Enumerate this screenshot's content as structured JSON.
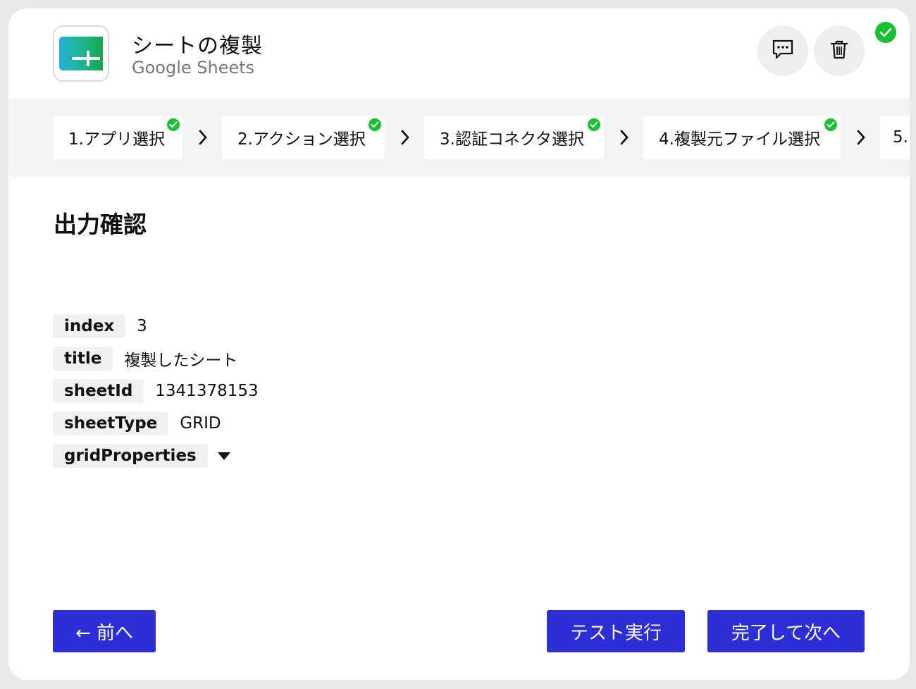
{
  "header": {
    "title": "シートの複製",
    "subtitle": "Google Sheets",
    "app_icon": "google-sheets-icon",
    "comment_icon": "comment-icon",
    "delete_icon": "trash-icon",
    "status": "complete"
  },
  "steps": [
    {
      "label": "1.アプリ選択",
      "done": true
    },
    {
      "label": "2.アクション選択",
      "done": true
    },
    {
      "label": "3.認証コネクタ選択",
      "done": true
    },
    {
      "label": "4.複製元ファイル選択",
      "done": true
    },
    {
      "label": "5.",
      "done": false
    }
  ],
  "main": {
    "section_title": "出力確認",
    "fields": [
      {
        "key": "index",
        "value": "3"
      },
      {
        "key": "title",
        "value": "複製したシート"
      },
      {
        "key": "sheetId",
        "value": "1341378153"
      },
      {
        "key": "sheetType",
        "value": "GRID"
      },
      {
        "key": "gridProperties",
        "value": ""
      }
    ]
  },
  "footer": {
    "prev_label": "← 前へ",
    "test_label": "テスト実行",
    "next_label": "完了して次へ"
  },
  "colors": {
    "primary": "#2d2ed6",
    "success": "#16c22f",
    "sheets_green": "#23a566",
    "steps_bg": "#f4f4f4"
  }
}
